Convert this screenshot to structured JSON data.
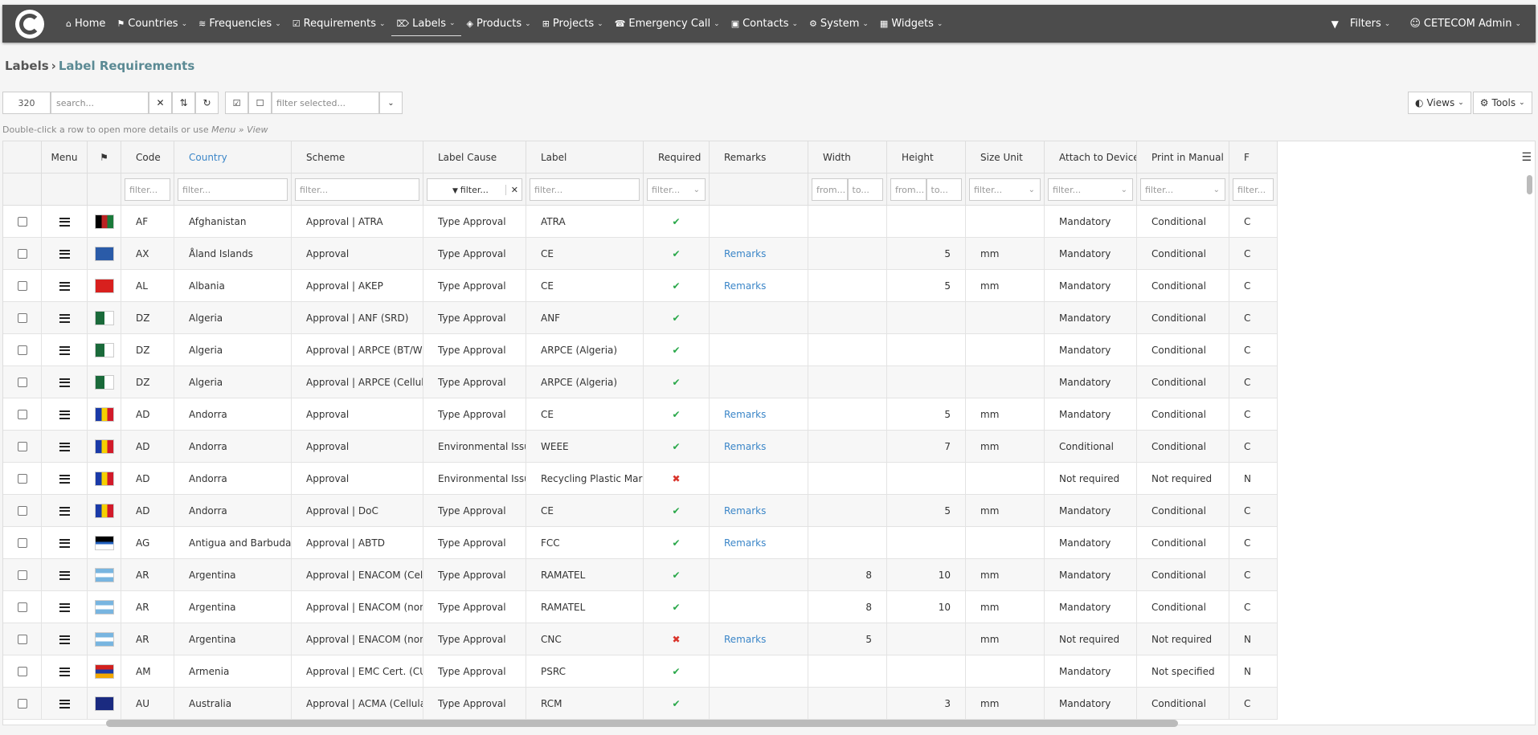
{
  "nav": {
    "items": [
      {
        "icon": "home-icon",
        "glyph": "⌂",
        "label": "Home",
        "chev": false
      },
      {
        "icon": "flag-icon",
        "glyph": "⚑",
        "label": "Countries",
        "chev": true
      },
      {
        "icon": "wifi-icon",
        "glyph": "≋",
        "label": "Frequencies",
        "chev": true
      },
      {
        "icon": "checklist-icon",
        "glyph": "☑",
        "label": "Requirements",
        "chev": true
      },
      {
        "icon": "tag-icon",
        "glyph": "⌦",
        "label": "Labels",
        "chev": true
      },
      {
        "icon": "cube-icon",
        "glyph": "◈",
        "label": "Products",
        "chev": true
      },
      {
        "icon": "sitemap-icon",
        "glyph": "⊞",
        "label": "Projects",
        "chev": true
      },
      {
        "icon": "phone-icon",
        "glyph": "☎",
        "label": "Emergency Call",
        "chev": true
      },
      {
        "icon": "address-card-icon",
        "glyph": "▣",
        "label": "Contacts",
        "chev": true
      },
      {
        "icon": "gears-icon",
        "glyph": "⚙",
        "label": "System",
        "chev": true
      },
      {
        "icon": "widgets-icon",
        "glyph": "▦",
        "label": "Widgets",
        "chev": true
      }
    ],
    "filters_label": "Filters",
    "user_label": "CETECOM Admin"
  },
  "breadcrumb": {
    "parent": "Labels",
    "sep": "›",
    "current": "Label Requirements"
  },
  "toolbar": {
    "count": "320",
    "search_placeholder": "search...",
    "filter_selected_placeholder": "filter selected...",
    "views_label": "Views",
    "tools_label": "Tools"
  },
  "hint": {
    "text": "Double-click a row to open more details or use ",
    "menu": "Menu",
    "sep": " » ",
    "view": "View"
  },
  "table": {
    "headers": {
      "menu": "Menu",
      "code": "Code",
      "country": "Country",
      "scheme": "Scheme",
      "cause": "Label Cause",
      "label": "Label",
      "required": "Required",
      "remarks": "Remarks",
      "width": "Width",
      "height": "Height",
      "unit": "Size Unit",
      "attach": "Attach to Device",
      "print": "Print in Manual",
      "extra": "F"
    },
    "filters": {
      "filter": "filter...",
      "from": "from...",
      "to": "to..."
    },
    "rows": [
      {
        "code": "AF",
        "country": "Afghanistan",
        "scheme": "Approval | ATRA",
        "cause": "Type Approval",
        "label": "ATRA",
        "required": true,
        "remarks": "",
        "width": "",
        "height": "",
        "unit": "",
        "attach": "Mandatory",
        "print": "Conditional",
        "extra": "C",
        "flag": "af"
      },
      {
        "code": "AX",
        "country": "Åland Islands",
        "scheme": "Approval",
        "cause": "Type Approval",
        "label": "CE",
        "required": true,
        "remarks": "Remarks",
        "width": "",
        "height": "5",
        "unit": "mm",
        "attach": "Mandatory",
        "print": "Conditional",
        "extra": "C",
        "flag": "ax"
      },
      {
        "code": "AL",
        "country": "Albania",
        "scheme": "Approval | AKEP",
        "cause": "Type Approval",
        "label": "CE",
        "required": true,
        "remarks": "Remarks",
        "width": "",
        "height": "5",
        "unit": "mm",
        "attach": "Mandatory",
        "print": "Conditional",
        "extra": "C",
        "flag": "al"
      },
      {
        "code": "DZ",
        "country": "Algeria",
        "scheme": "Approval | ANF (SRD)",
        "cause": "Type Approval",
        "label": "ANF",
        "required": true,
        "remarks": "",
        "width": "",
        "height": "",
        "unit": "",
        "attach": "Mandatory",
        "print": "Conditional",
        "extra": "C",
        "flag": "dz"
      },
      {
        "code": "DZ",
        "country": "Algeria",
        "scheme": "Approval | ARPCE (BT/WLA...",
        "cause": "Type Approval",
        "label": "ARPCE (Algeria)",
        "required": true,
        "remarks": "",
        "width": "",
        "height": "",
        "unit": "",
        "attach": "Mandatory",
        "print": "Conditional",
        "extra": "C",
        "flag": "dz"
      },
      {
        "code": "DZ",
        "country": "Algeria",
        "scheme": "Approval | ARPCE (Cellular)",
        "cause": "Type Approval",
        "label": "ARPCE (Algeria)",
        "required": true,
        "remarks": "",
        "width": "",
        "height": "",
        "unit": "",
        "attach": "Mandatory",
        "print": "Conditional",
        "extra": "C",
        "flag": "dz"
      },
      {
        "code": "AD",
        "country": "Andorra",
        "scheme": "Approval",
        "cause": "Type Approval",
        "label": "CE",
        "required": true,
        "remarks": "Remarks",
        "width": "",
        "height": "5",
        "unit": "mm",
        "attach": "Mandatory",
        "print": "Conditional",
        "extra": "C",
        "flag": "ad"
      },
      {
        "code": "AD",
        "country": "Andorra",
        "scheme": "Approval",
        "cause": "Environmental Issues",
        "label": "WEEE",
        "required": true,
        "remarks": "Remarks",
        "width": "",
        "height": "7",
        "unit": "mm",
        "attach": "Conditional",
        "print": "Conditional",
        "extra": "C",
        "flag": "ad"
      },
      {
        "code": "AD",
        "country": "Andorra",
        "scheme": "Approval",
        "cause": "Environmental Issues",
        "label": "Recycling Plastic Mark",
        "required": false,
        "remarks": "",
        "width": "",
        "height": "",
        "unit": "",
        "attach": "Not required",
        "print": "Not required",
        "extra": "N",
        "flag": "ad"
      },
      {
        "code": "AD",
        "country": "Andorra",
        "scheme": "Approval | DoC",
        "cause": "Type Approval",
        "label": "CE",
        "required": true,
        "remarks": "Remarks",
        "width": "",
        "height": "5",
        "unit": "mm",
        "attach": "Mandatory",
        "print": "Conditional",
        "extra": "C",
        "flag": "ad"
      },
      {
        "code": "AG",
        "country": "Antigua and Barbuda",
        "scheme": "Approval | ABTD",
        "cause": "Type Approval",
        "label": "FCC",
        "required": true,
        "remarks": "Remarks",
        "width": "",
        "height": "",
        "unit": "",
        "attach": "Mandatory",
        "print": "Conditional",
        "extra": "C",
        "flag": "ag"
      },
      {
        "code": "AR",
        "country": "Argentina",
        "scheme": "Approval | ENACOM (Cellul...",
        "cause": "Type Approval",
        "label": "RAMATEL",
        "required": true,
        "remarks": "",
        "width": "8",
        "height": "10",
        "unit": "mm",
        "attach": "Mandatory",
        "print": "Conditional",
        "extra": "C",
        "flag": "ar"
      },
      {
        "code": "AR",
        "country": "Argentina",
        "scheme": "Approval | ENACOM (non-C...",
        "cause": "Type Approval",
        "label": "RAMATEL",
        "required": true,
        "remarks": "",
        "width": "8",
        "height": "10",
        "unit": "mm",
        "attach": "Mandatory",
        "print": "Conditional",
        "extra": "C",
        "flag": "ar"
      },
      {
        "code": "AR",
        "country": "Argentina",
        "scheme": "Approval | ENACOM (non-C...",
        "cause": "Type Approval",
        "label": "CNC",
        "required": false,
        "remarks": "Remarks",
        "width": "5",
        "height": "",
        "unit": "mm",
        "attach": "Not required",
        "print": "Not required",
        "extra": "N",
        "flag": "ar"
      },
      {
        "code": "AM",
        "country": "Armenia",
        "scheme": "Approval | EMC Cert. (CU)",
        "cause": "Type Approval",
        "label": "PSRC",
        "required": true,
        "remarks": "",
        "width": "",
        "height": "",
        "unit": "",
        "attach": "Mandatory",
        "print": "Not specified",
        "extra": "N",
        "flag": "am"
      },
      {
        "code": "AU",
        "country": "Australia",
        "scheme": "Approval | ACMA (Cellular)",
        "cause": "Type Approval",
        "label": "RCM",
        "required": true,
        "remarks": "",
        "width": "",
        "height": "3",
        "unit": "mm",
        "attach": "Mandatory",
        "print": "Conditional",
        "extra": "C",
        "flag": "au"
      }
    ]
  },
  "colors": {
    "navbar": "#4c4c4c",
    "link": "#3b86c8",
    "ok": "#2aa84a",
    "no": "#d9342b",
    "breadcrumb_current": "#5b8a94"
  }
}
